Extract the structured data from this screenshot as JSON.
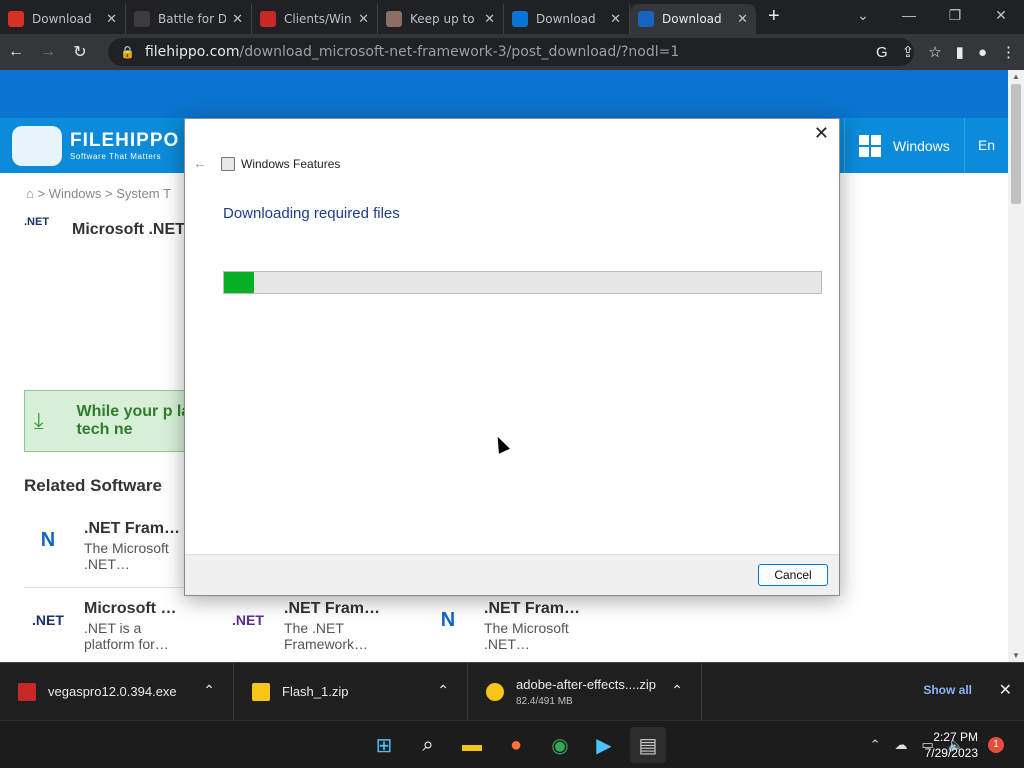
{
  "browser": {
    "tabs": [
      {
        "title": "Download",
        "fav_color": "#d93025"
      },
      {
        "title": "Battle for D",
        "fav_color": "#3c3c3c"
      },
      {
        "title": "Clients/Win",
        "fav_color": "#c62828"
      },
      {
        "title": "Keep up to",
        "fav_color": "#8d6e63"
      },
      {
        "title": "Download",
        "fav_color": "#0b74d0"
      },
      {
        "title": "Download",
        "fav_color": "#1565c0"
      }
    ],
    "url_host": "filehippo.com",
    "url_path": "/download_microsoft-net-framework-3/post_download/?nodl=1"
  },
  "site": {
    "logo_name": "FILEHIPPO",
    "logo_tagline": "Software That Matters",
    "nav_windows": "Windows",
    "nav_lang": "En",
    "breadcrumb": "> Windows > System T",
    "product_title": "Microsoft .NET",
    "net_logo_text": ".NET",
    "banner_text": "While your p latest tech ne",
    "related_heading": "Related Software",
    "related": [
      {
        "name": ".NET Fram…",
        "desc": "The Microsoft .NET…",
        "icon": "N"
      },
      {
        "name": "Microsoft …",
        "desc": ".NET is a platform for…",
        "icon": ".NET"
      },
      {
        "name": ".NET Fram…",
        "desc": "The .NET Framework…",
        "icon": ".NET"
      },
      {
        "name": ".NET Fram…",
        "desc": "The Microsoft .NET…",
        "icon": "N"
      }
    ]
  },
  "dialog": {
    "window_title": "Windows Features",
    "heading": "Downloading required files",
    "progress_fraction": 0.05,
    "cancel_label": "Cancel"
  },
  "downloads": {
    "items": [
      {
        "name": "vegaspro12.0.394.exe",
        "size": "",
        "icon_color": "#c62828"
      },
      {
        "name": "Flash_1.zip",
        "size": "",
        "icon_color": "#f5c518"
      },
      {
        "name": "adobe-after-effects....zip",
        "size": "82.4/491 MB",
        "icon_color": "#f5c518"
      }
    ],
    "show_all": "Show all"
  },
  "taskbar": {
    "time": "2:27 PM",
    "date": "7/29/2023",
    "notifications": "1"
  }
}
